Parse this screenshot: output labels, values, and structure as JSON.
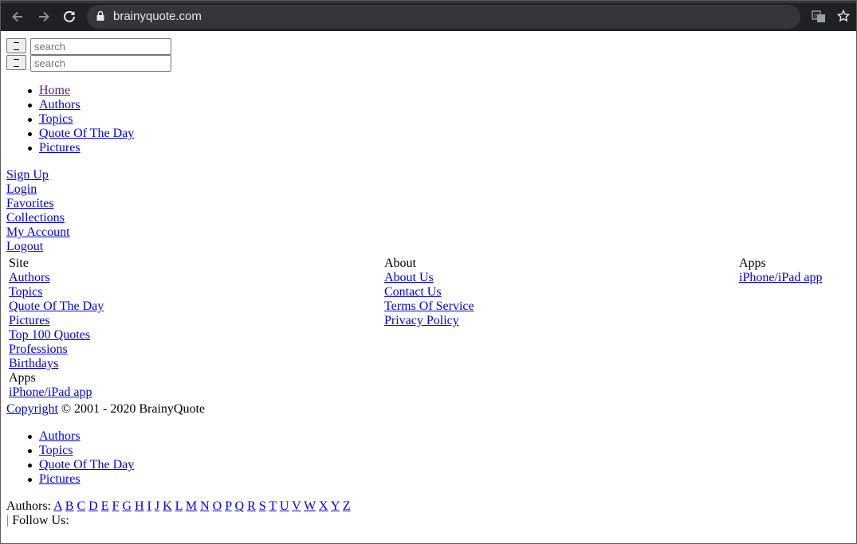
{
  "browser": {
    "url": "brainyquote.com",
    "back_icon": "arrow-left-icon",
    "forward_icon": "arrow-right-icon",
    "reload_icon": "reload-icon",
    "lock_icon": "lock-icon",
    "translate_icon": "translate-icon",
    "bookmark_icon": "star-icon"
  },
  "search": {
    "placeholder": "search"
  },
  "main_nav": [
    "Home",
    "Authors",
    "Topics",
    "Quote Of The Day",
    "Pictures"
  ],
  "account_links": [
    "Sign Up",
    "Login",
    "Favorites",
    "Collections",
    "My Account",
    "Logout"
  ],
  "footer": {
    "site": {
      "heading": "Site",
      "links": [
        "Authors",
        "Topics",
        "Quote Of The Day",
        "Pictures",
        "Top 100 Quotes",
        "Professions",
        "Birthdays"
      ],
      "apps_heading": "Apps",
      "apps_link": "iPhone/iPad app"
    },
    "about": {
      "heading": "About",
      "links": [
        "About Us",
        "Contact Us",
        "Terms Of Service",
        "Privacy Policy"
      ]
    },
    "apps": {
      "heading": "Apps",
      "links": [
        "iPhone/iPad app"
      ]
    },
    "copyright_link": "Copyright",
    "copyright_text": " © 2001 - 2020 BrainyQuote"
  },
  "bottom_nav": [
    "Authors",
    "Topics",
    "Quote Of The Day",
    "Pictures"
  ],
  "authors_index": {
    "label": "Authors:",
    "letters": [
      "A",
      "B",
      "C",
      "D",
      "E",
      "F",
      "G",
      "H",
      "I",
      "J",
      "K",
      "L",
      "M",
      "N",
      "O",
      "P",
      "Q",
      "R",
      "S",
      "T",
      "U",
      "V",
      "W",
      "X",
      "Y",
      "Z"
    ]
  },
  "follow": {
    "separator": "|",
    "label": " Follow Us:"
  }
}
